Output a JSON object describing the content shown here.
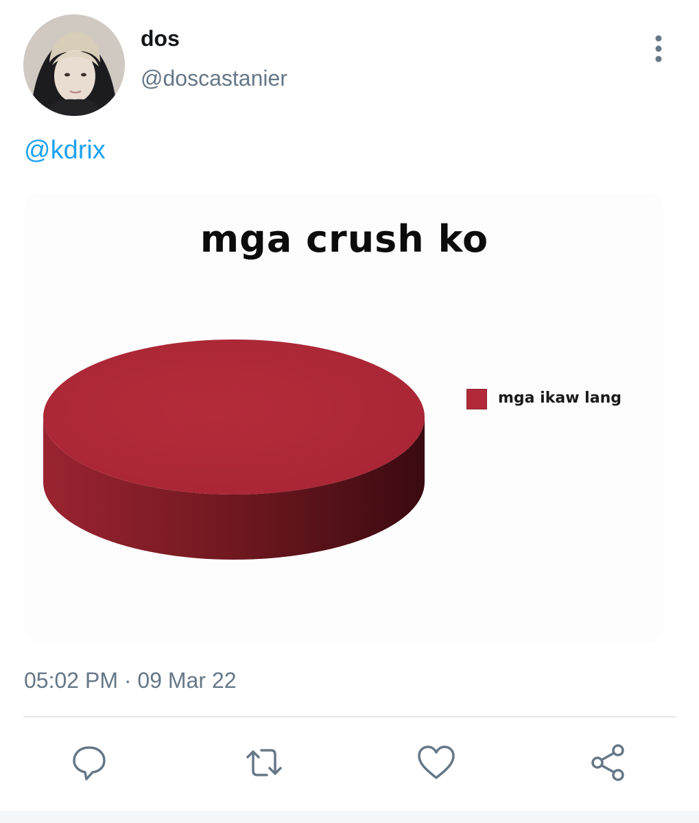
{
  "tweet": {
    "display_name": "dos",
    "handle": "@doscastanier",
    "mention": "@kdrix",
    "timestamp": "05:02 PM · 09 Mar 22",
    "avatar_icon": "avatar-photo"
  },
  "actions": {
    "reply_icon": "reply-icon",
    "retweet_icon": "retweet-icon",
    "like_icon": "heart-icon",
    "share_icon": "share-icon",
    "more_icon": "more-vertical-icon"
  },
  "colors": {
    "link": "#1da1f2",
    "muted": "#657786",
    "pie_top": "#b22a3a",
    "pie_side": "#7d1b25"
  },
  "chart_data": {
    "type": "pie",
    "title": "mga crush ko",
    "labels": [
      "mga ikaw lang"
    ],
    "values": [
      100
    ],
    "legend": "right",
    "style": "3d"
  }
}
